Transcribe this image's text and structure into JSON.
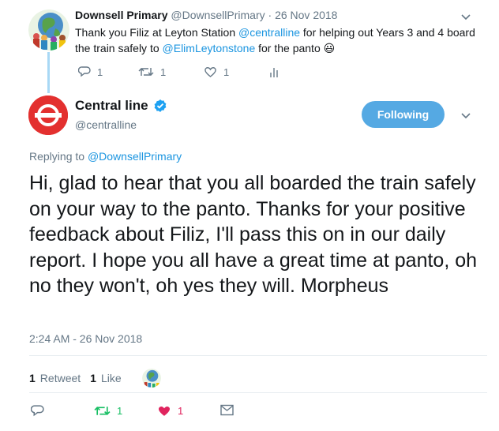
{
  "parent": {
    "name": "Downsell Primary",
    "handle": "@DownsellPrimary",
    "separator": "·",
    "date": "26 Nov 2018",
    "text_parts": [
      {
        "t": "Thank you Filiz at Leyton Station ",
        "link": false
      },
      {
        "t": "@centralline",
        "link": true
      },
      {
        "t": " for helping out Years 3 and 4 board the train safely to ",
        "link": false
      },
      {
        "t": "@ElimLeytonstone",
        "link": true
      },
      {
        "t": " for the panto ",
        "link": false
      }
    ],
    "emoji": "😃",
    "reply_count": "1",
    "retweet_count": "1",
    "like_count": "1"
  },
  "main": {
    "name": "Central line",
    "handle": "@centralline",
    "follow_label": "Following",
    "replying_prefix": "Replying to ",
    "replying_handle": "@DownsellPrimary",
    "body": "Hi, glad to hear that you all boarded the train safely on your way to the panto. Thanks for your positive feedback about Filiz, I'll pass this on in our daily report. I hope you all have a great time at panto, oh no they won't, oh yes they will.  Morpheus",
    "timestamp": "2:24 AM - 26 Nov 2018",
    "retweets_count": "1",
    "retweets_label": "Retweet",
    "likes_count": "1",
    "likes_label": "Like",
    "retweet_action_count": "1",
    "like_action_count": "1"
  },
  "colors": {
    "link": "#1b95e0",
    "retweeted": "#17bf63",
    "liked": "#e0245e",
    "tfl_red": "#e3302f",
    "follow_button": "#55a9e3"
  }
}
